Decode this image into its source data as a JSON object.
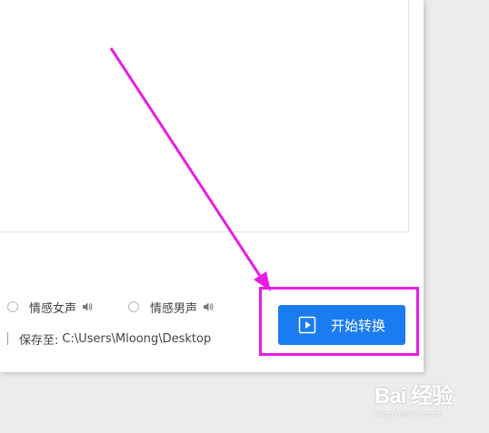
{
  "voices": [
    {
      "label": "情感女声",
      "icon": "speaker-icon"
    },
    {
      "label": "情感男声",
      "icon": "speaker-icon"
    }
  ],
  "save": {
    "label": "保存至:",
    "path": "C:\\Users\\Mloong\\Desktop"
  },
  "convert_button": {
    "label": "开始转换",
    "icon": "play-icon"
  },
  "watermark": {
    "main": "Bai 经验",
    "sub": "jingyan.baidu.com"
  },
  "colors": {
    "accent": "#1a7cf0",
    "annotation": "#e81ce8"
  }
}
